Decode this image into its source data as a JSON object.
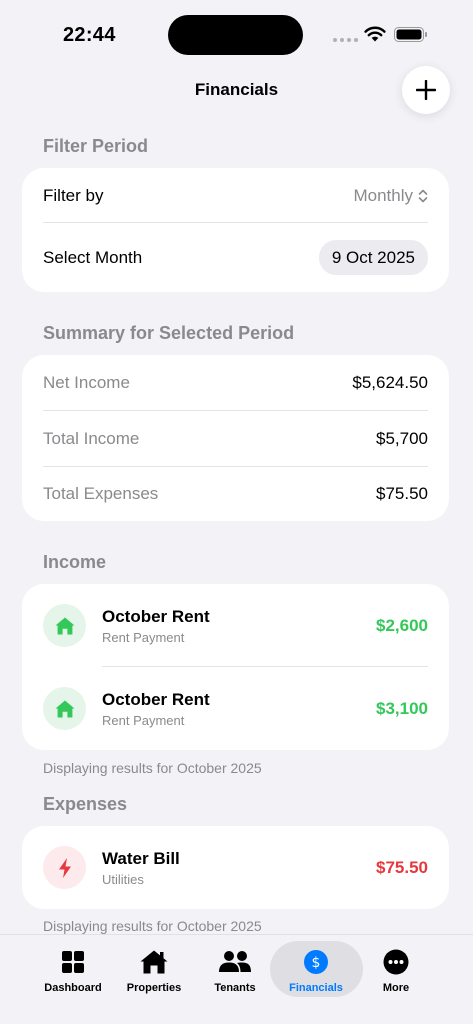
{
  "status": {
    "time": "22:44"
  },
  "nav": {
    "title": "Financials"
  },
  "filter": {
    "header": "Filter Period",
    "filter_by_label": "Filter by",
    "filter_by_value": "Monthly",
    "select_month_label": "Select Month",
    "select_month_value": "9 Oct 2025"
  },
  "summary": {
    "header": "Summary for Selected Period",
    "rows": [
      {
        "label": "Net Income",
        "value": "$5,624.50"
      },
      {
        "label": "Total Income",
        "value": "$5,700"
      },
      {
        "label": "Total Expenses",
        "value": "$75.50"
      }
    ]
  },
  "income": {
    "header": "Income",
    "items": [
      {
        "title": "October Rent",
        "subtitle": "Rent Payment",
        "amount": "$2,600",
        "icon": "house-icon"
      },
      {
        "title": "October Rent",
        "subtitle": "Rent Payment",
        "amount": "$3,100",
        "icon": "house-icon"
      }
    ],
    "footnote": "Displaying results for October 2025"
  },
  "expenses": {
    "header": "Expenses",
    "items": [
      {
        "title": "Water Bill",
        "subtitle": "Utilities",
        "amount": "$75.50",
        "icon": "bolt-icon"
      }
    ],
    "footnote": "Displaying results for October 2025"
  },
  "tabs": [
    {
      "label": "Dashboard",
      "icon": "grid-icon"
    },
    {
      "label": "Properties",
      "icon": "house-icon"
    },
    {
      "label": "Tenants",
      "icon": "people-icon"
    },
    {
      "label": "Financials",
      "icon": "dollar-icon",
      "active": true
    },
    {
      "label": "More",
      "icon": "ellipsis-icon"
    }
  ],
  "colors": {
    "accent": "#007aff",
    "income_green": "#34c759",
    "expense_red": "#e5393f",
    "background": "#f2f2f7"
  }
}
